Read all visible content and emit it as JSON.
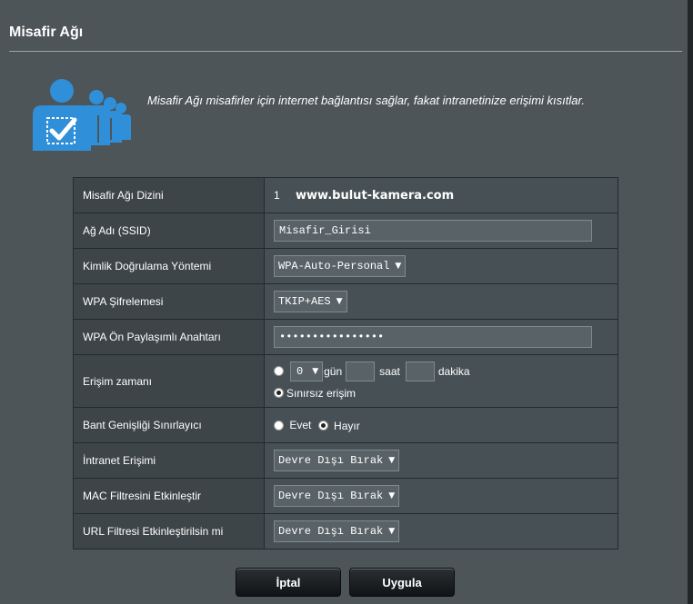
{
  "page": {
    "title": "Misafir Ağı",
    "description": "Misafir Ağı misafirler için internet bağlantısı sağlar, fakat intranetinize erişimi kısıtlar."
  },
  "colors": {
    "accent": "#2f8fd8",
    "background": "#4d5559",
    "label_cell": "#3d4548",
    "value_cell": "#475155"
  },
  "rows": {
    "index": {
      "label": "Misafir Ağı Dizini",
      "number": "1",
      "site": "www.bulut-kamera.com"
    },
    "ssid": {
      "label": "Ağ Adı (SSID)",
      "value": "Misafir_Girisi"
    },
    "auth": {
      "label": "Kimlik Doğrulama Yöntemi",
      "selected": "WPA-Auto-Personal"
    },
    "encryption": {
      "label": "WPA Şifrelemesi",
      "selected": "TKIP+AES"
    },
    "psk": {
      "label": "WPA Ön Paylaşımlı Anahtarı",
      "value": "••••••••••••••••"
    },
    "access_time": {
      "label": "Erişim zamanı",
      "day_value": "0",
      "day_label": "gün",
      "hour_label": "saat",
      "minute_label": "dakika",
      "unlimited_label": "Sınırsız erişim"
    },
    "bandwidth": {
      "label": "Bant Genişliği Sınırlayıcı",
      "yes_label": "Evet",
      "no_label": "Hayır"
    },
    "intranet": {
      "label": "İntranet Erişimi",
      "selected": "Devre Dışı Bırak"
    },
    "mac_filter": {
      "label": "MAC Filtresini Etkinleştir",
      "selected": "Devre Dışı Bırak"
    },
    "url_filter": {
      "label": "URL Filtresi Etkinleştirilsin mi",
      "selected": "Devre Dışı Bırak"
    }
  },
  "buttons": {
    "cancel": "İptal",
    "apply": "Uygula"
  },
  "icons": {
    "guest_network": "guest-users-checkmark-icon",
    "dropdown": "chevron-down-icon"
  }
}
